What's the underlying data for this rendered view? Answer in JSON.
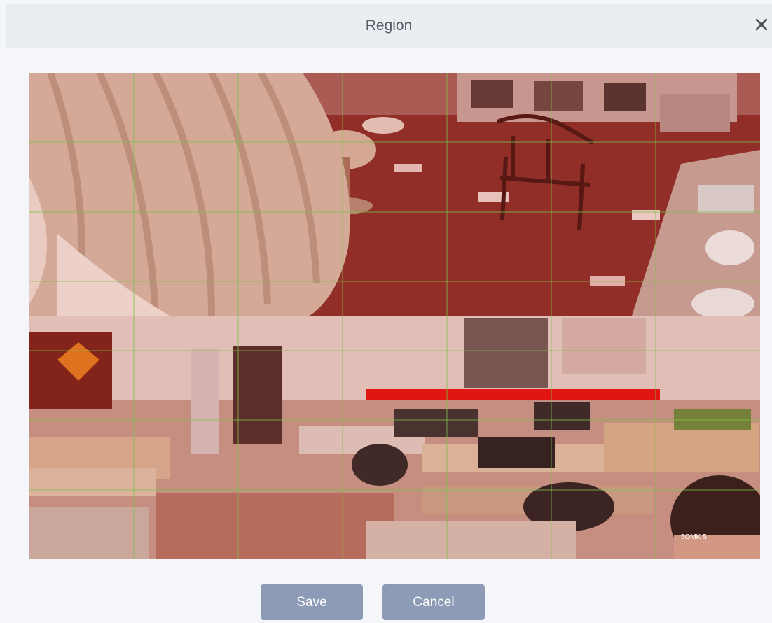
{
  "dialog": {
    "title": "Region",
    "close_glyph": "✕",
    "close_icon": "close-icon"
  },
  "preview": {
    "description_icon": "camera-preview",
    "grid": {
      "columns": 7,
      "rows": 7,
      "line_color": "#7fbf4a"
    },
    "overlay_color": "#c0392b",
    "caption_overlay_text": "5OMK 5"
  },
  "actions": {
    "save_label": "Save",
    "cancel_label": "Cancel",
    "button_color": "#8e9bb6"
  }
}
